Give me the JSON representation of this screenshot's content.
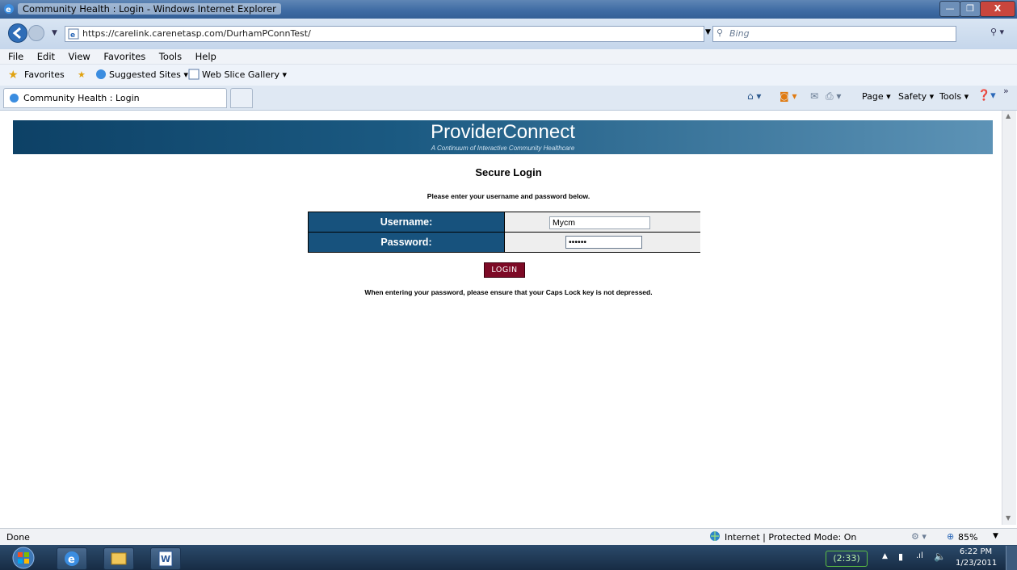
{
  "window": {
    "title": "Community Health : Login - Windows Internet Explorer",
    "minimize": "—",
    "maximize": "❐",
    "close": "X"
  },
  "address": {
    "url": "https://carelink.carenetasp.com/DurhamPConnTest/",
    "search_placeholder": "Bing"
  },
  "menu": [
    "File",
    "Edit",
    "View",
    "Favorites",
    "Tools",
    "Help"
  ],
  "favorites": {
    "label": "Favorites",
    "items": [
      "Suggested Sites ▾",
      "Web Slice Gallery ▾"
    ]
  },
  "tabs": {
    "active": "Community Health : Login"
  },
  "command_bar": {
    "page": "Page ▾",
    "safety": "Safety ▾",
    "tools": "Tools ▾",
    "overflow": "»"
  },
  "page": {
    "banner_title": "ProviderConnect",
    "banner_subtitle": "A Continuum of Interactive Community Healthcare",
    "heading": "Secure Login",
    "instructions": "Please enter your username and password below.",
    "username_label": "Username:",
    "username_value": "Mycm",
    "password_label": "Password:",
    "password_value": "••••••",
    "login_button": "LOGIN",
    "caps_note": "When entering your password, please ensure that your Caps Lock key is not depressed."
  },
  "status": {
    "left": "Done",
    "zone": "Internet | Protected Mode: On",
    "zoom": "85%"
  },
  "taskbar": {
    "battery": "(2:33)",
    "time": "6:22 PM",
    "date": "1/23/2011"
  },
  "colors": {
    "banner": "#17527d",
    "login_button": "#7d0a26"
  }
}
